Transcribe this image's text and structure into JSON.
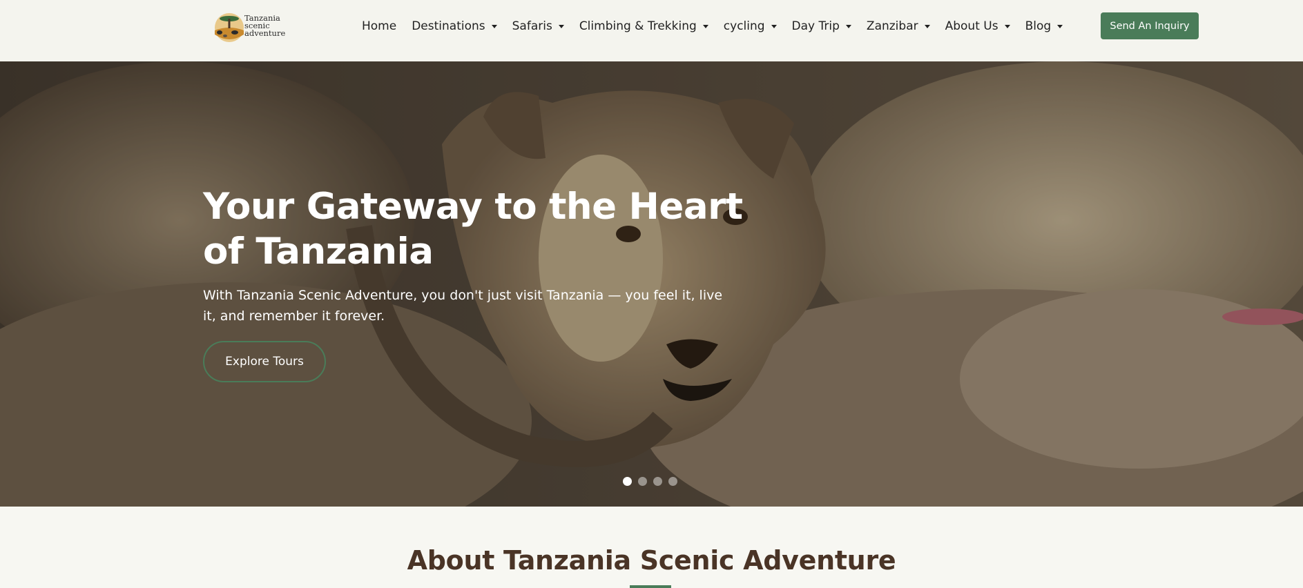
{
  "header": {
    "logo_text": "Tanzania scenic adventure",
    "nav": [
      {
        "label": "Home",
        "dropdown": false
      },
      {
        "label": "Destinations",
        "dropdown": true
      },
      {
        "label": "Safaris",
        "dropdown": true
      },
      {
        "label": "Climbing & Trekking",
        "dropdown": true
      },
      {
        "label": "cycling",
        "dropdown": true
      },
      {
        "label": "Day Trip",
        "dropdown": true
      },
      {
        "label": "Zanzibar",
        "dropdown": true
      },
      {
        "label": "About Us",
        "dropdown": true
      },
      {
        "label": "Blog",
        "dropdown": true
      }
    ],
    "inquiry_label": "Send An Inquiry"
  },
  "hero": {
    "title": "Your Gateway to the Heart of Tanzania",
    "subtitle": "With Tanzania Scenic Adventure, you don't just visit Tanzania — you feel it, live it, and remember it forever.",
    "button_label": "Explore Tours",
    "slides_count": 4,
    "active_slide": 1
  },
  "about": {
    "title": "About Tanzania Scenic Adventure"
  },
  "colors": {
    "accent": "#4a7c59",
    "heading": "#4a3426",
    "background": "#f7f7f2"
  }
}
